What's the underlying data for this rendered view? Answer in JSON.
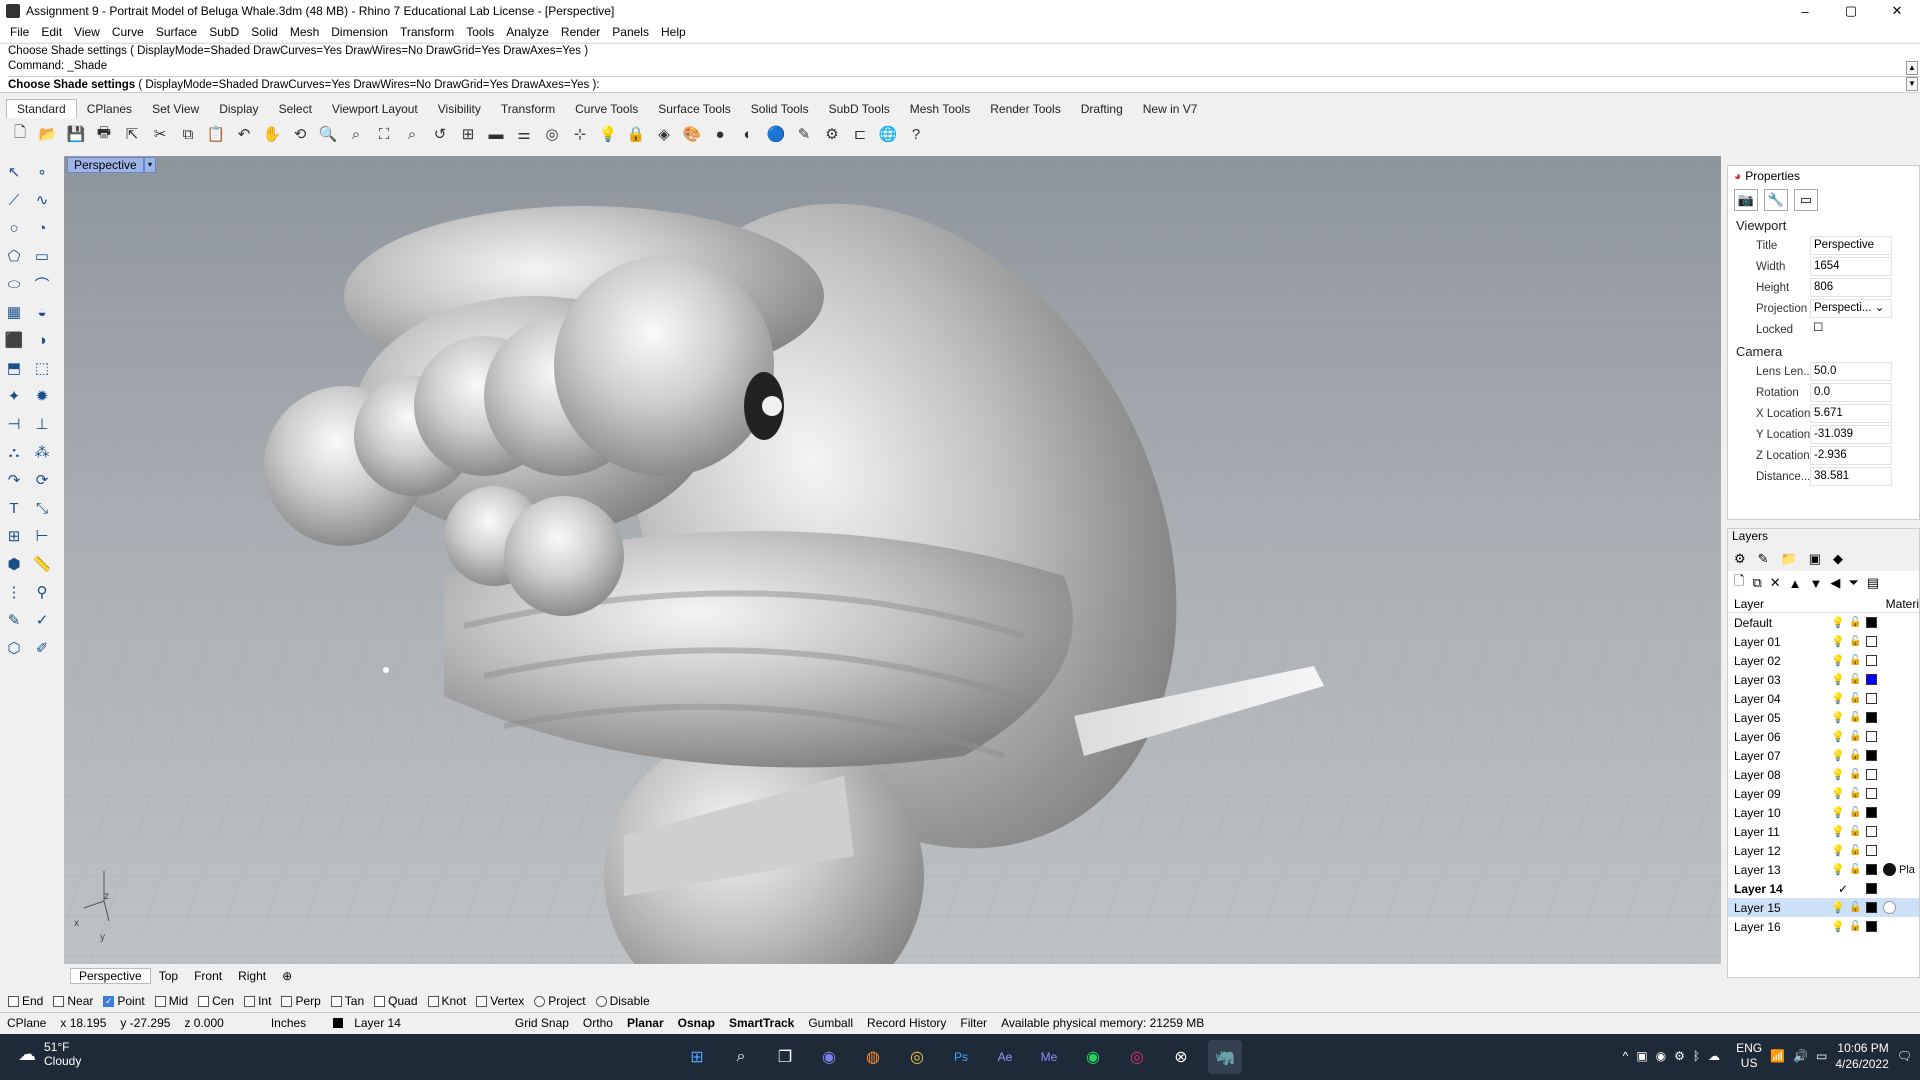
{
  "window": {
    "title": "Assignment 9 - Portrait Model of Beluga Whale.3dm (48 MB) - Rhino 7 Educational Lab License - [Perspective]",
    "min": "–",
    "max": "▢",
    "close": "✕"
  },
  "menu": [
    "File",
    "Edit",
    "View",
    "Curve",
    "Surface",
    "SubD",
    "Solid",
    "Mesh",
    "Dimension",
    "Transform",
    "Tools",
    "Analyze",
    "Render",
    "Panels",
    "Help"
  ],
  "command": {
    "history1": "Choose Shade settings ( DisplayMode=Shaded  DrawCurves=Yes  DrawWires=No  DrawGrid=Yes  DrawAxes=Yes )",
    "history2": "Command: _Shade",
    "prompt_bold": "Choose Shade settings",
    "prompt_rest": " ( DisplayMode=Shaded  DrawCurves=Yes  DrawWires=No  DrawGrid=Yes  DrawAxes=Yes ):"
  },
  "toolbar_tabs": [
    "Standard",
    "CPlanes",
    "Set View",
    "Display",
    "Select",
    "Viewport Layout",
    "Visibility",
    "Transform",
    "Curve Tools",
    "Surface Tools",
    "Solid Tools",
    "SubD Tools",
    "Mesh Tools",
    "Render Tools",
    "Drafting",
    "New in V7"
  ],
  "viewport": {
    "name": "Perspective",
    "dropdown": "▾",
    "axis_z": "z",
    "axis_x": "x",
    "axis_y": "y"
  },
  "viewport_tabs": [
    "Perspective",
    "Top",
    "Front",
    "Right",
    "⊕"
  ],
  "osnaps": [
    {
      "label": "End",
      "on": false
    },
    {
      "label": "Near",
      "on": false
    },
    {
      "label": "Point",
      "on": true
    },
    {
      "label": "Mid",
      "on": false
    },
    {
      "label": "Cen",
      "on": false
    },
    {
      "label": "Int",
      "on": false
    },
    {
      "label": "Perp",
      "on": false
    },
    {
      "label": "Tan",
      "on": false
    },
    {
      "label": "Quad",
      "on": false
    },
    {
      "label": "Knot",
      "on": false
    },
    {
      "label": "Vertex",
      "on": false
    },
    {
      "label": "Project",
      "on": false
    },
    {
      "label": "Disable",
      "on": false
    }
  ],
  "status": {
    "cplane": "CPlane",
    "x": "x 18.195",
    "y": "y -27.295",
    "z": "z 0.000",
    "units": "Inches",
    "layer": "Layer 14",
    "grid_snap": "Grid Snap",
    "ortho": "Ortho",
    "planar": "Planar",
    "osnap": "Osnap",
    "smarttrack": "SmartTrack",
    "gumball": "Gumball",
    "record_history": "Record History",
    "filter": "Filter",
    "memory": "Available physical memory: 21259 MB"
  },
  "properties": {
    "title": "Properties",
    "viewport_section": "Viewport",
    "camera_section": "Camera",
    "rows": [
      {
        "k": "Title",
        "v": "Perspective"
      },
      {
        "k": "Width",
        "v": "1654"
      },
      {
        "k": "Height",
        "v": "806"
      },
      {
        "k": "Projection",
        "v": "Perspecti... ⌄"
      },
      {
        "k": "Locked",
        "v": "☐"
      }
    ],
    "camera": [
      {
        "k": "Lens Len...",
        "v": "50.0"
      },
      {
        "k": "Rotation",
        "v": "0.0"
      },
      {
        "k": "X Location",
        "v": "5.671"
      },
      {
        "k": "Y Location",
        "v": "-31.039"
      },
      {
        "k": "Z Location",
        "v": "-2.936"
      },
      {
        "k": "Distance...",
        "v": "38.581"
      }
    ]
  },
  "layers": {
    "title": "Layers",
    "col_layer": "Layer",
    "col_material": "Materi",
    "rows": [
      {
        "name": "Default",
        "color": "#000000"
      },
      {
        "name": "Layer 01",
        "color": "#ffffff"
      },
      {
        "name": "Layer 02",
        "color": "#ffffff"
      },
      {
        "name": "Layer 03",
        "color": "#0000ff"
      },
      {
        "name": "Layer 04",
        "color": "#ffffff"
      },
      {
        "name": "Layer 05",
        "color": "#000000"
      },
      {
        "name": "Layer 06",
        "color": "#ffffff"
      },
      {
        "name": "Layer 07",
        "color": "#000000"
      },
      {
        "name": "Layer 08",
        "color": "#ffffff"
      },
      {
        "name": "Layer 09",
        "color": "#ffffff"
      },
      {
        "name": "Layer 10",
        "color": "#000000"
      },
      {
        "name": "Layer 11",
        "color": "#ffffff"
      },
      {
        "name": "Layer 12",
        "color": "#ffffff"
      },
      {
        "name": "Layer 13",
        "color": "#000000",
        "material": "Pla"
      },
      {
        "name": "Layer 14",
        "color": "#000000",
        "current": "✓"
      },
      {
        "name": "Layer 15",
        "color": "#000000"
      },
      {
        "name": "Layer 16",
        "color": "#000000"
      }
    ]
  },
  "taskbar": {
    "temp": "51°F",
    "weather": "Cloudy",
    "lang1": "ENG",
    "lang2": "US",
    "time": "10:06 PM",
    "date": "4/26/2022"
  }
}
